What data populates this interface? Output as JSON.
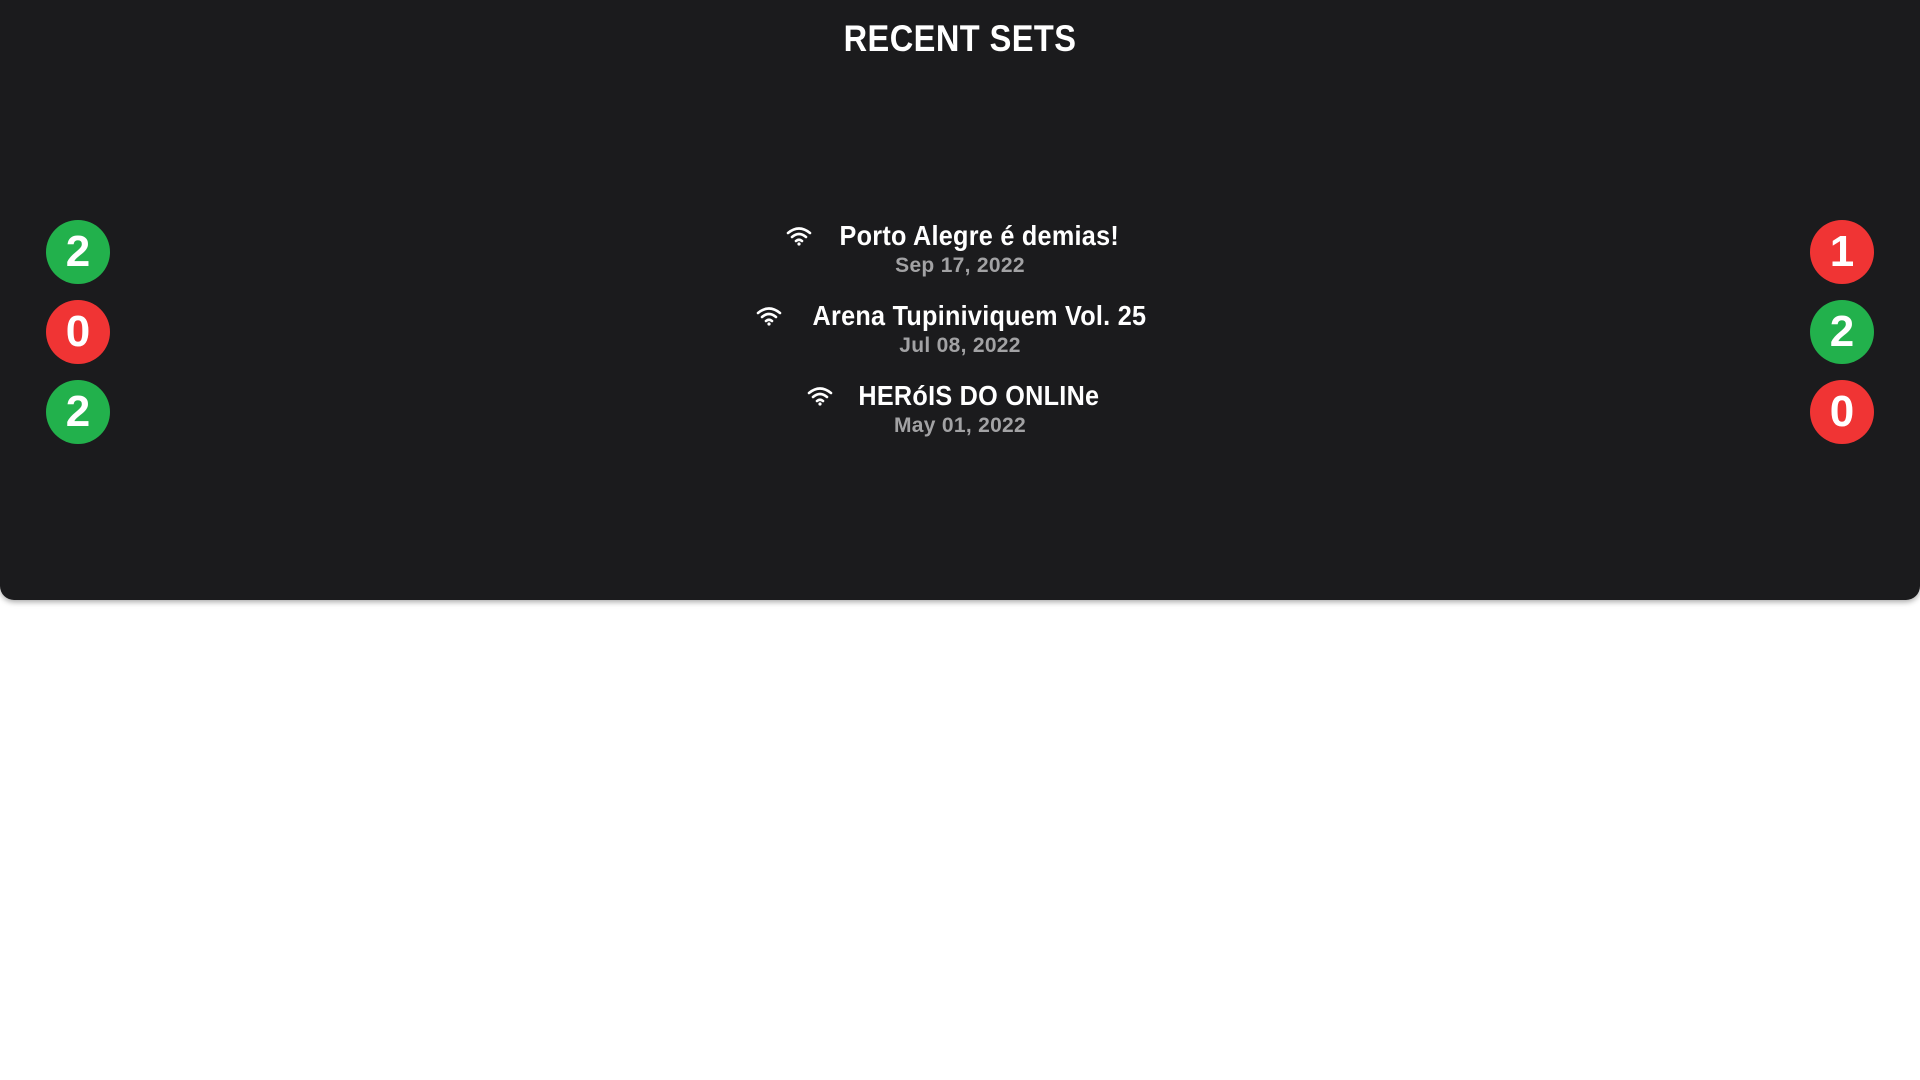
{
  "panel": {
    "title": "RECENT SETS"
  },
  "colors": {
    "panel_bg": "#1b1b1d",
    "win": "#22b14c",
    "loss": "#f03434",
    "date": "#a2a2a4"
  },
  "sets": [
    {
      "event_name": "Porto Alegre é demias!",
      "date": "Sep 17, 2022",
      "icon": "wifi-icon",
      "left_score": "2",
      "left_result": "win",
      "right_score": "1",
      "right_result": "loss"
    },
    {
      "event_name": "Arena Tupiniviquem Vol. 25",
      "date": "Jul 08, 2022",
      "icon": "wifi-icon",
      "left_score": "0",
      "left_result": "loss",
      "right_score": "2",
      "right_result": "win"
    },
    {
      "event_name": "HERóIS DO ONLINe",
      "date": "May 01, 2022",
      "icon": "wifi-icon",
      "left_score": "2",
      "left_result": "win",
      "right_score": "0",
      "right_result": "loss"
    }
  ]
}
